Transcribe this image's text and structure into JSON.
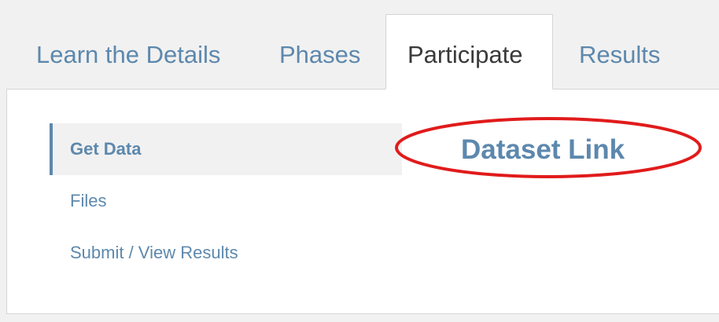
{
  "tabs": [
    {
      "label": "Learn the Details",
      "active": false
    },
    {
      "label": "Phases",
      "active": false
    },
    {
      "label": "Participate",
      "active": true
    },
    {
      "label": "Results",
      "active": false
    }
  ],
  "sidenav": {
    "items": [
      {
        "label": "Get Data",
        "active": true
      },
      {
        "label": "Files",
        "active": false
      },
      {
        "label": "Submit / View Results",
        "active": false
      }
    ]
  },
  "content": {
    "heading": "Dataset Link"
  },
  "annotation": {
    "shape": "ellipse",
    "color": "#e11b1b"
  },
  "colors": {
    "link": "#5d88ad",
    "active_tab_text": "#3a3a3a",
    "background": "#f1f1f1",
    "panel": "#ffffff"
  }
}
